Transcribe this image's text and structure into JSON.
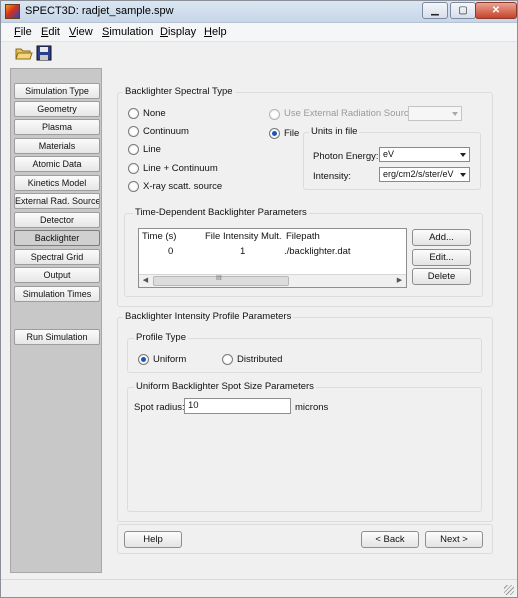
{
  "window": {
    "title": "SPECT3D:  radjet_sample.spw"
  },
  "menu": [
    {
      "label_first": "F",
      "label_rest": "ile"
    },
    {
      "label_first": "E",
      "label_rest": "dit"
    },
    {
      "label_first": "V",
      "label_rest": "iew"
    },
    {
      "label_first": "S",
      "label_rest": "imulation"
    },
    {
      "label_first": "D",
      "label_rest": "isplay"
    },
    {
      "label_first": "H",
      "label_rest": "elp"
    }
  ],
  "sidebar": {
    "items": [
      {
        "label": "Simulation Type"
      },
      {
        "label": "Geometry"
      },
      {
        "label": "Plasma"
      },
      {
        "label": "Materials"
      },
      {
        "label": "Atomic Data"
      },
      {
        "label": "Kinetics Model"
      },
      {
        "label": "External Rad. Source"
      },
      {
        "label": "Detector"
      },
      {
        "label": "Backlighter"
      },
      {
        "label": "Spectral Grid"
      },
      {
        "label": "Output"
      },
      {
        "label": "Simulation Times"
      }
    ],
    "active_index": 8,
    "run_button": "Run Simulation"
  },
  "spectral_type": {
    "title": "Backlighter Spectral Type",
    "options": [
      "None",
      "Continuum",
      "Line",
      "Line + Continuum",
      "X-ray scatt. source"
    ],
    "use_external": "Use External Radiation Source",
    "file": "File",
    "selected": "File",
    "units": {
      "title": "Units in file",
      "photon_energy_label": "Photon Energy:",
      "photon_energy_value": "eV",
      "intensity_label": "Intensity:",
      "intensity_value": "erg/cm2/s/ster/eV"
    }
  },
  "time_dependent": {
    "title": "Time-Dependent Backlighter Parameters",
    "columns": [
      "Time (s)",
      "File Intensity Mult.",
      "Filepath"
    ],
    "rows": [
      {
        "time": "0",
        "mult": "1",
        "path": "./backlighter.dat"
      }
    ],
    "buttons": {
      "add": "Add...",
      "edit": "Edit...",
      "delete": "Delete"
    },
    "scroll_grip": "III"
  },
  "profile": {
    "title": "Backlighter Intensity Profile Parameters",
    "profile_type_title": "Profile Type",
    "options": [
      "Uniform",
      "Distributed"
    ],
    "selected": "Uniform",
    "spot": {
      "title": "Uniform Backlighter Spot Size Parameters",
      "label": "Spot radius:",
      "value": "10",
      "unit": "microns"
    }
  },
  "footer": {
    "help": "Help",
    "back": "< Back",
    "next": "Next >"
  }
}
